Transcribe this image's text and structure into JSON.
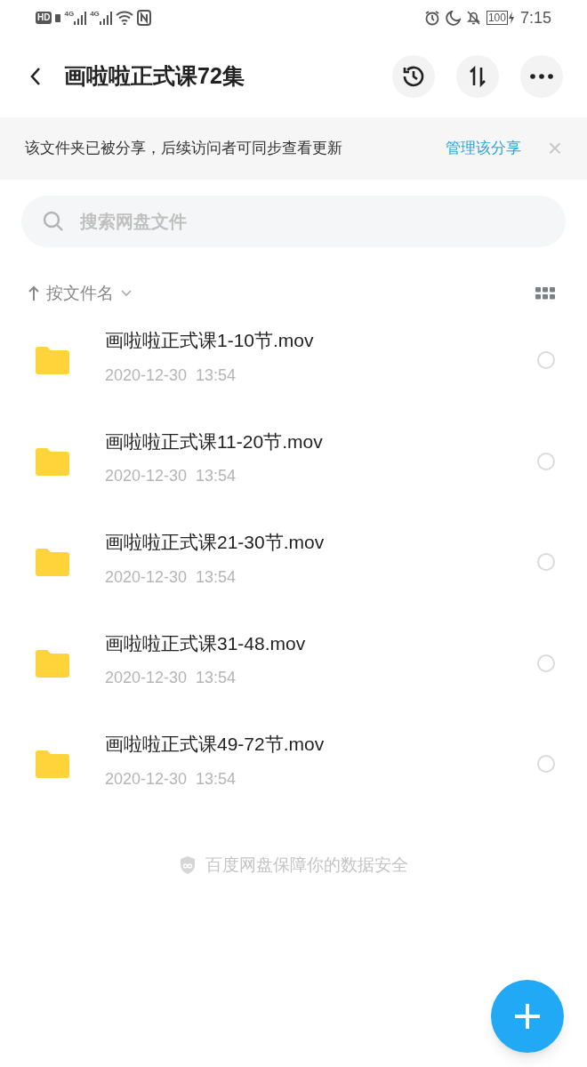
{
  "status_bar": {
    "hd": "HD",
    "sim_labels": [
      "4G",
      "4G"
    ],
    "battery": "100",
    "time": "7:15"
  },
  "header": {
    "title": "画啦啦正式课72集"
  },
  "share_banner": {
    "message": "该文件夹已被分享，后续访问者可同步查看更新",
    "link": "管理该分享",
    "close": "×"
  },
  "search": {
    "placeholder": "搜索网盘文件"
  },
  "sort": {
    "label": "按文件名"
  },
  "files": [
    {
      "name": "画啦啦正式课1-10节.mov",
      "date": "2020-12-30  13:54",
      "selected": false
    },
    {
      "name": "画啦啦正式课11-20节.mov",
      "date": "2020-12-30  13:54",
      "selected": false
    },
    {
      "name": "画啦啦正式课21-30节.mov",
      "date": "2020-12-30  13:54",
      "selected": false
    },
    {
      "name": "画啦啦正式课31-48.mov",
      "date": "2020-12-30  13:54",
      "selected": false
    },
    {
      "name": "画啦啦正式课49-72节.mov",
      "date": "2020-12-30  13:54",
      "selected": false
    }
  ],
  "footer": {
    "text": "百度网盘保障你的数据安全"
  }
}
